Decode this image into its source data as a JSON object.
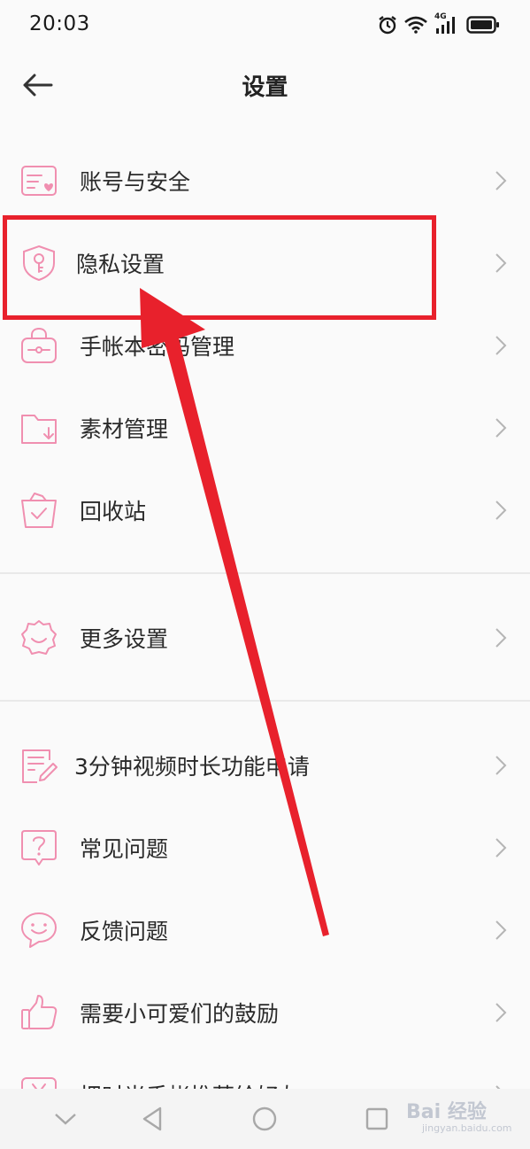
{
  "status_bar": {
    "time": "20:03",
    "network": "4G",
    "icons": [
      "alarm-icon",
      "wifi-icon",
      "signal-icon",
      "battery-icon"
    ]
  },
  "header": {
    "title": "设置",
    "back_icon": "back-arrow-icon"
  },
  "groups": [
    {
      "items": [
        {
          "label": "账号与安全",
          "icon": "account-card-icon"
        },
        {
          "label": "隐私设置",
          "icon": "shield-key-icon"
        },
        {
          "label": "手帐本密码管理",
          "icon": "lock-bag-icon"
        },
        {
          "label": "素材管理",
          "icon": "folder-download-icon"
        },
        {
          "label": "回收站",
          "icon": "recycle-bin-icon"
        }
      ]
    },
    {
      "items": [
        {
          "label": "更多设置",
          "icon": "gear-smile-icon"
        }
      ]
    },
    {
      "items": [
        {
          "label": "3分钟视频时长功能申请",
          "icon": "edit-document-icon"
        },
        {
          "label": "常见问题",
          "icon": "question-icon"
        },
        {
          "label": "反馈问题",
          "icon": "smile-bubble-icon"
        },
        {
          "label": "需要小可爱们的鼓励",
          "icon": "thumbs-up-icon"
        },
        {
          "label": "把时光手帐推荐给好友",
          "icon": "yen-icon"
        }
      ]
    }
  ],
  "colors": {
    "accent_pink": "#f08fb0",
    "annotation_red": "#e8212c"
  },
  "nav_bar": {
    "icons": [
      "collapse-chevron-icon",
      "back-triangle-icon",
      "home-circle-icon",
      "recents-square-icon"
    ]
  },
  "watermark": {
    "main": "Bai 经验",
    "sub": "jingyan.baidu.com"
  }
}
